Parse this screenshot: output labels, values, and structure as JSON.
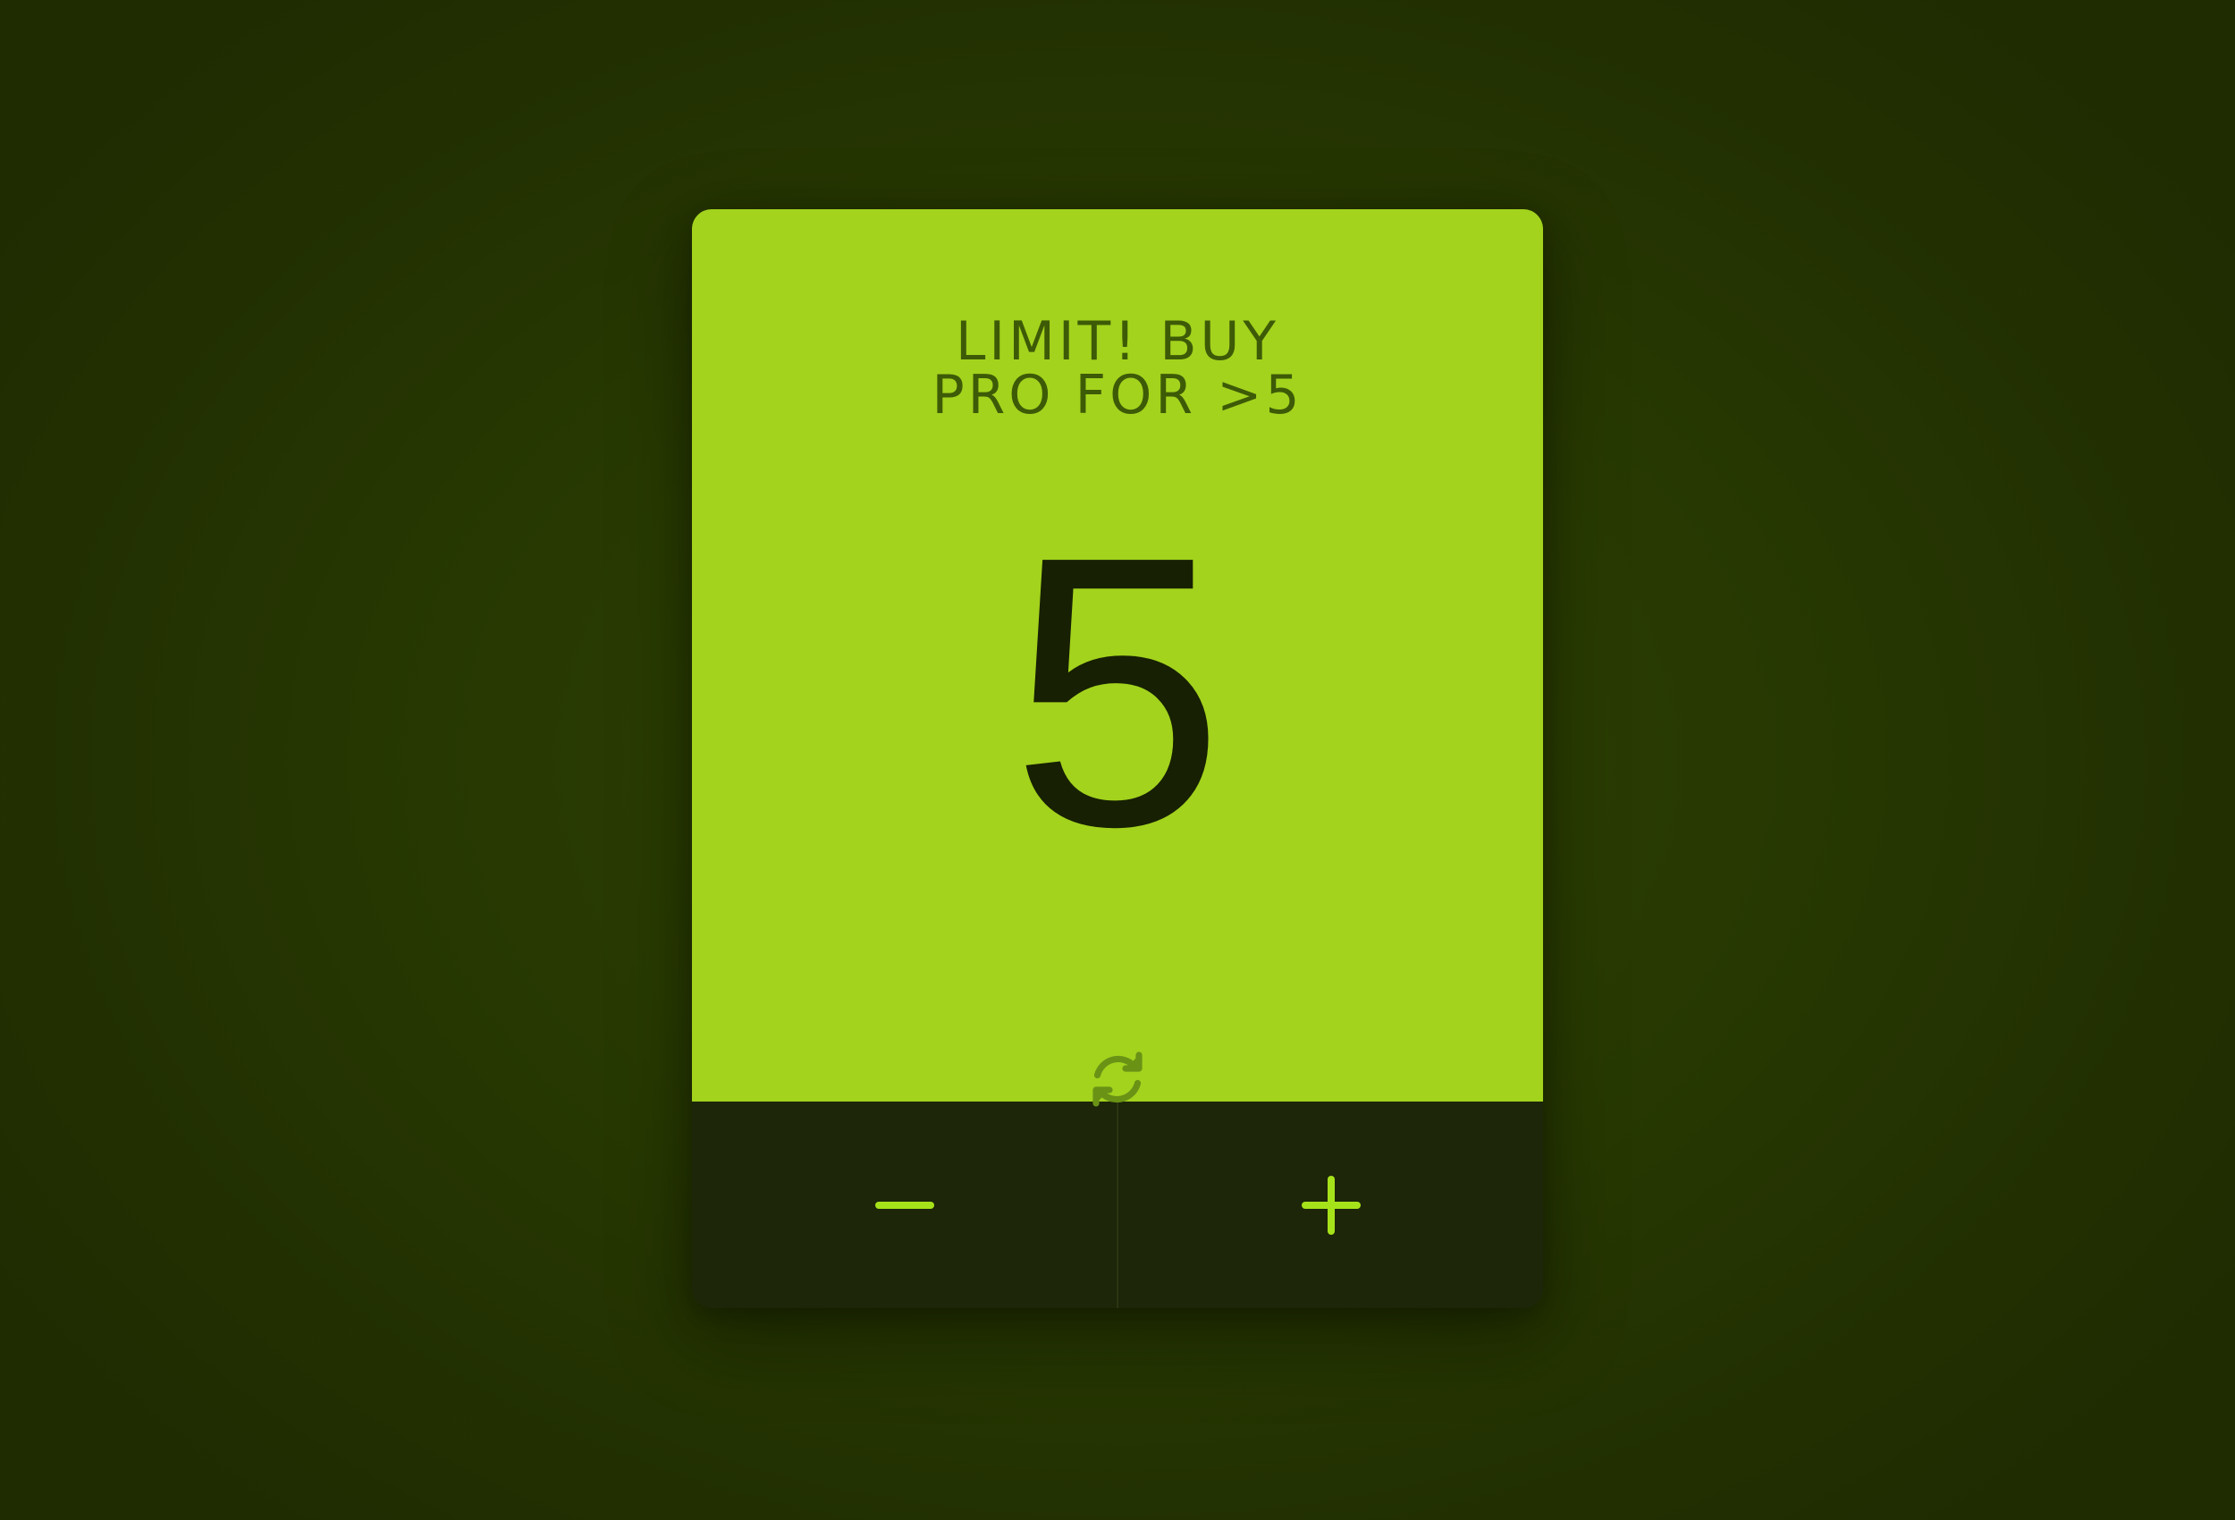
{
  "counter": {
    "limit_message": "LIMIT! BUY\nPRO FOR >5",
    "value": "5",
    "reset_icon": "refresh-icon"
  },
  "controls": {
    "decrement_icon": "minus-icon",
    "increment_icon": "plus-icon"
  },
  "colors": {
    "background": "#283a02",
    "display": "#a3d31d",
    "message_text": "#3d5a07",
    "value_text": "#172003",
    "controls_bg": "#1d2609",
    "accent": "#a6e21a"
  }
}
